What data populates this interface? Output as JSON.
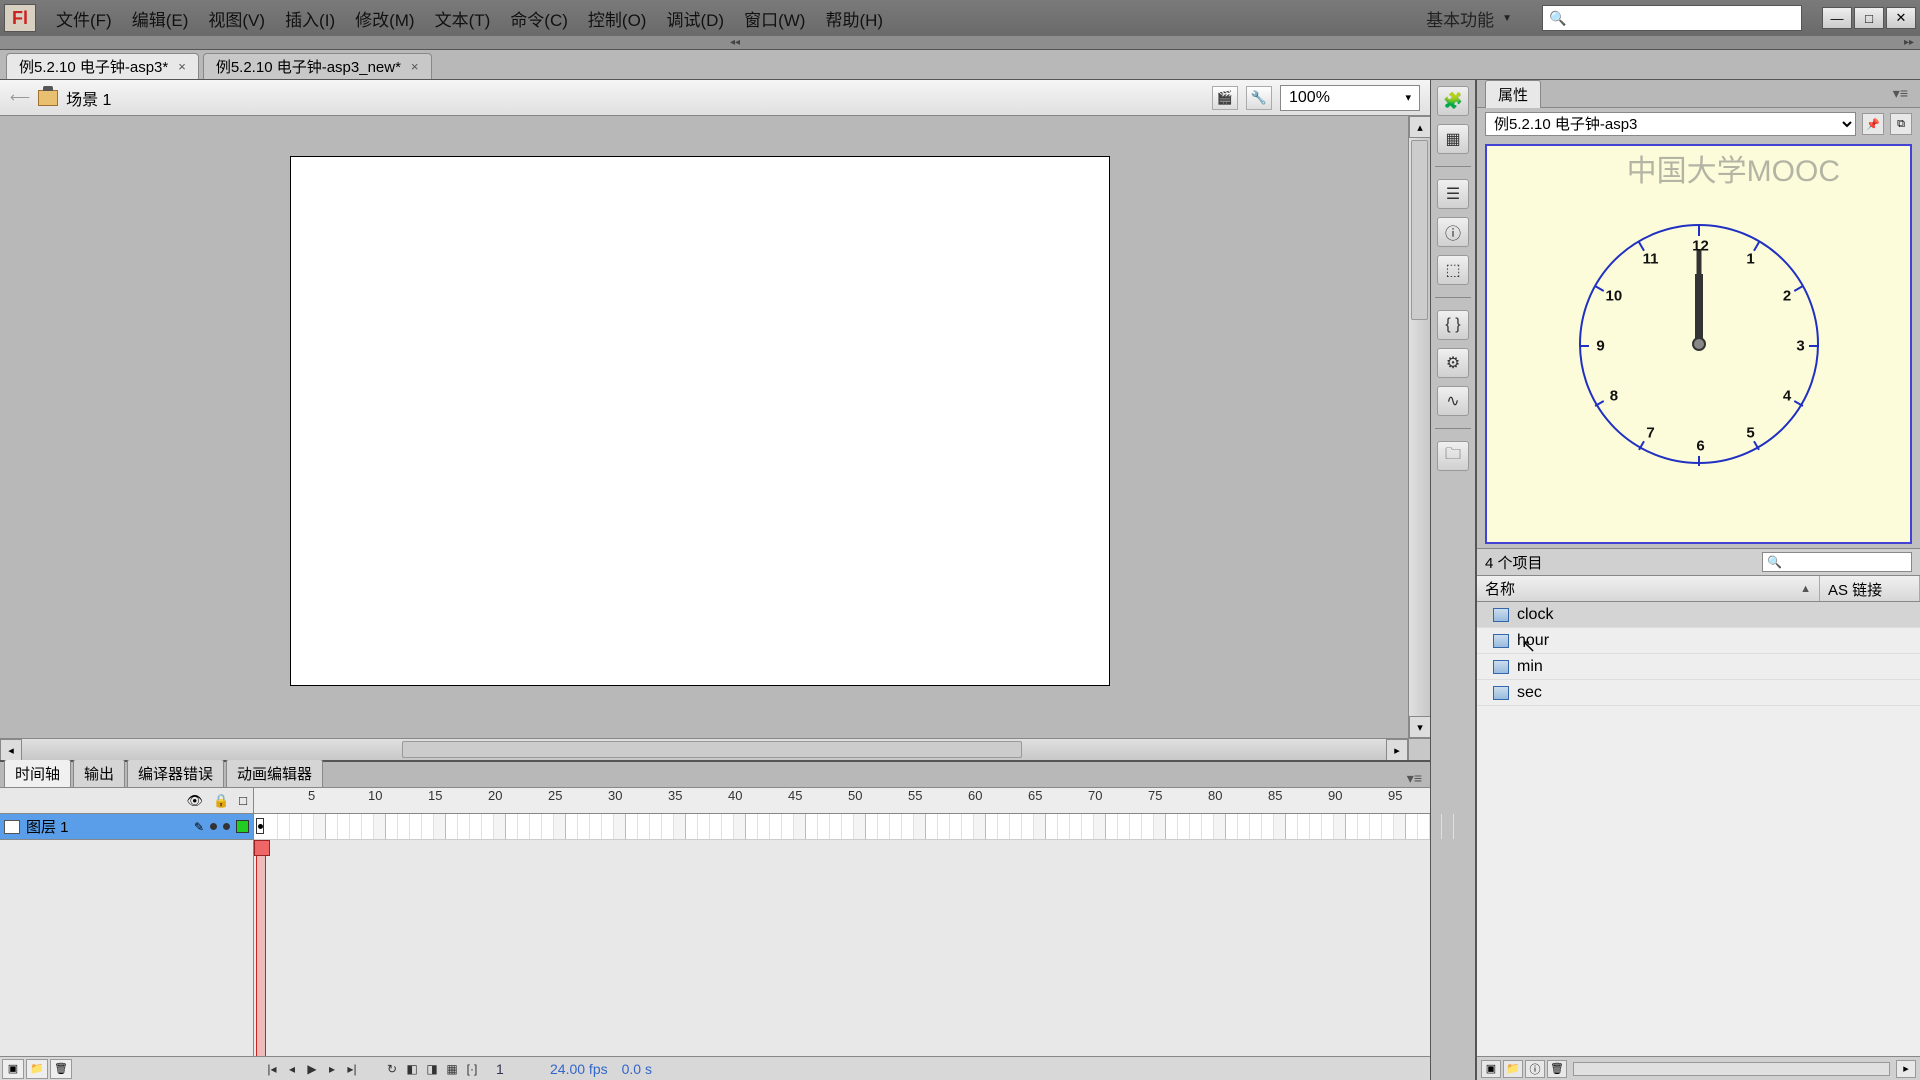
{
  "menu": {
    "file": "文件(F)",
    "edit": "编辑(E)",
    "view": "视图(V)",
    "insert": "插入(I)",
    "modify": "修改(M)",
    "text": "文本(T)",
    "commands": "命令(C)",
    "control": "控制(O)",
    "debug": "调试(D)",
    "window": "窗口(W)",
    "help": "帮助(H)"
  },
  "workspace_label": "基本功能",
  "top_search_placeholder": "",
  "tabs": [
    {
      "title": "例5.2.10  电子钟-asp3*",
      "active": true
    },
    {
      "title": "例5.2.10  电子钟-asp3_new*",
      "active": false
    }
  ],
  "scene_name": "场景 1",
  "zoom": "100%",
  "timeline": {
    "tabs": [
      "时间轴",
      "输出",
      "编译器错误",
      "动画编辑器"
    ],
    "layer_name": "图层 1",
    "ruler": [
      5,
      10,
      15,
      20,
      25,
      30,
      35,
      40,
      45,
      50,
      55,
      60,
      65,
      70,
      75,
      80,
      85,
      90,
      95
    ],
    "frame_current": "1",
    "fps": "24.00 fps",
    "time": "0.0 s"
  },
  "library": {
    "panel_tab": "属性",
    "doc_name": "例5.2.10  电子钟-asp3",
    "count_label": "4 个项目",
    "col_name": "名称",
    "col_link": "AS 链接",
    "items": [
      "clock",
      "hour",
      "min",
      "sec"
    ],
    "clock_numbers": [
      "12",
      "1",
      "2",
      "3",
      "4",
      "5",
      "6",
      "7",
      "8",
      "9",
      "10",
      "11"
    ]
  },
  "watermark": "中国大学MOOC"
}
